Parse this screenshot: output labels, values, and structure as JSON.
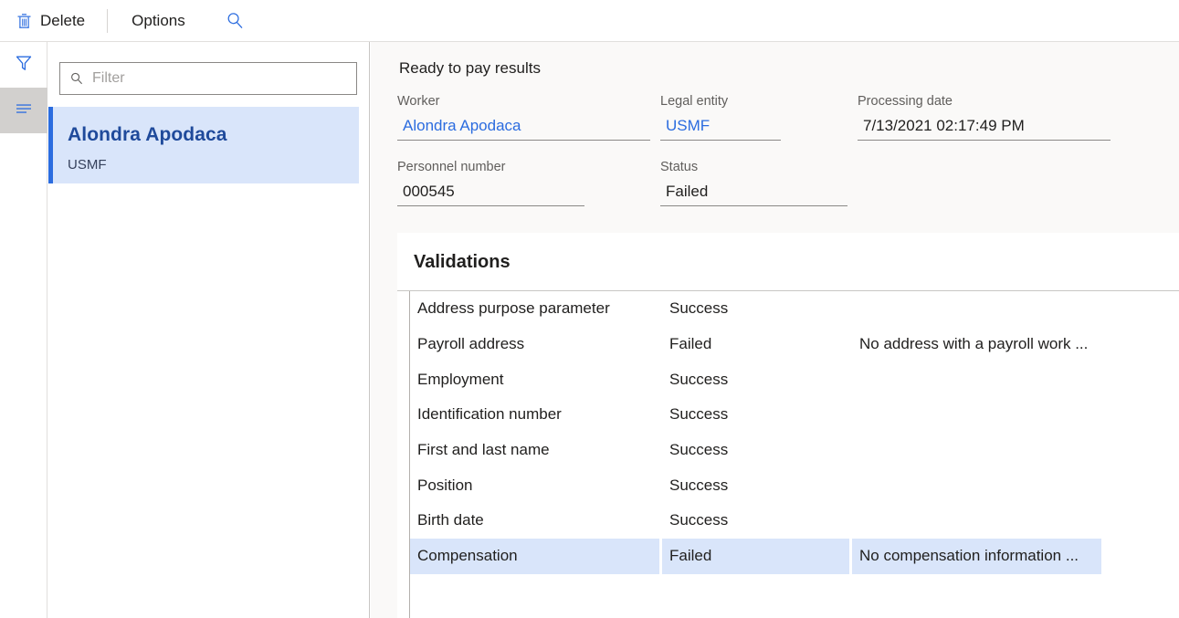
{
  "toolbar": {
    "delete_label": "Delete",
    "options_label": "Options",
    "delete_icon": "trash-icon",
    "search_icon": "search-icon"
  },
  "rail": {
    "filter_icon": "funnel-filter-icon",
    "list_icon": "list-lines-icon"
  },
  "list_panel": {
    "filter": {
      "placeholder": "Filter",
      "value": "",
      "icon": "search-icon"
    },
    "items": [
      {
        "title": "Alondra Apodaca",
        "subtitle": "USMF",
        "selected": true
      }
    ]
  },
  "detail": {
    "section_title": "Ready to pay results",
    "fields": {
      "worker": {
        "label": "Worker",
        "value": "Alondra Apodaca"
      },
      "legal_entity": {
        "label": "Legal entity",
        "value": "USMF"
      },
      "processing_date": {
        "label": "Processing date",
        "value": "7/13/2021 02:17:49 PM"
      },
      "personnel_number": {
        "label": "Personnel number",
        "value": "000545"
      },
      "status": {
        "label": "Status",
        "value": "Failed"
      }
    },
    "validations": {
      "title": "Validations",
      "rows": [
        {
          "name": "Address purpose parameter",
          "status": "Success",
          "message": "",
          "selected": false
        },
        {
          "name": "Payroll address",
          "status": "Failed",
          "message": "No address with a payroll work ...",
          "selected": false
        },
        {
          "name": "Employment",
          "status": "Success",
          "message": "",
          "selected": false
        },
        {
          "name": "Identification number",
          "status": "Success",
          "message": "",
          "selected": false
        },
        {
          "name": "First and last name",
          "status": "Success",
          "message": "",
          "selected": false
        },
        {
          "name": "Position",
          "status": "Success",
          "message": "",
          "selected": false
        },
        {
          "name": "Birth date",
          "status": "Success",
          "message": "",
          "selected": false
        },
        {
          "name": "Compensation",
          "status": "Failed",
          "message": "No compensation information ...",
          "selected": true
        }
      ]
    }
  },
  "colors": {
    "accent": "#2b6cdf",
    "selection": "#d9e5fa",
    "pane_background": "#faf9f8",
    "rail_active": "#d2d0ce"
  }
}
